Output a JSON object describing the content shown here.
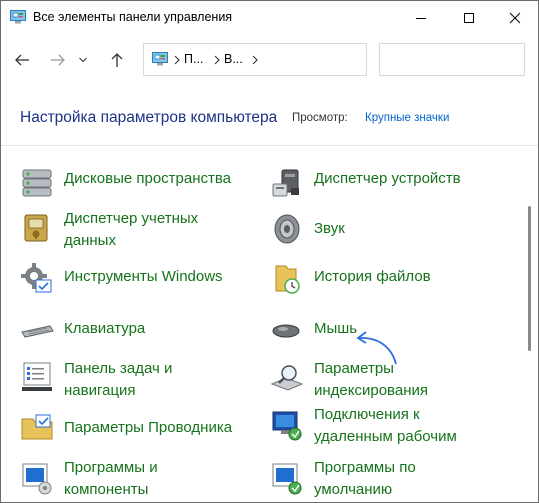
{
  "window": {
    "title": "Все элементы панели управления"
  },
  "address": {
    "crumbs": [
      "П...",
      "В..."
    ]
  },
  "search": {
    "placeholder": ""
  },
  "header": {
    "heading": "Настройка параметров компьютера",
    "view_label": "Просмотр:",
    "view_value": "Крупные значки"
  },
  "items": [
    {
      "label": "Дисковые пространства",
      "icon": "storage-spaces-icon"
    },
    {
      "label": "Диспетчер устройств",
      "icon": "device-manager-icon"
    },
    {
      "label": "Диспетчер учетных\nданных",
      "icon": "credential-manager-icon"
    },
    {
      "label": "Звук",
      "icon": "sound-icon"
    },
    {
      "label": "Инструменты Windows",
      "icon": "windows-tools-icon"
    },
    {
      "label": "История файлов",
      "icon": "file-history-icon"
    },
    {
      "label": "Клавиатура",
      "icon": "keyboard-icon"
    },
    {
      "label": "Мышь",
      "icon": "mouse-icon"
    },
    {
      "label": "Панель задач и\nнавигация",
      "icon": "taskbar-icon"
    },
    {
      "label": "Параметры\nиндексирования",
      "icon": "indexing-icon"
    },
    {
      "label": "Параметры Проводника",
      "icon": "explorer-options-icon"
    },
    {
      "label": "Подключения к\nудаленным рабочим",
      "icon": "remote-connections-icon"
    },
    {
      "label": "Программы и\nкомпоненты",
      "icon": "programs-features-icon"
    },
    {
      "label": "Программы по\nумолчанию",
      "icon": "default-programs-icon"
    }
  ],
  "colors": {
    "heading": "#1e3287",
    "link": "#15731b",
    "view_link": "#0066cc",
    "annotation_arrow": "#2a6fdb"
  }
}
